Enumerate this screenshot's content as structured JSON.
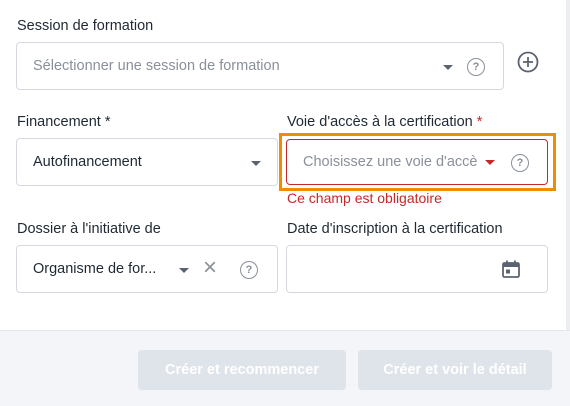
{
  "session": {
    "label": "Session de formation",
    "placeholder": "Sélectionner une session de formation"
  },
  "financement": {
    "label": "Financement",
    "required_mark": "*",
    "value": "Autofinancement"
  },
  "voie_acces": {
    "label": "Voie d'accès à la certification",
    "required_mark": "*",
    "placeholder": "Choisissez une voie d'accès",
    "error": "Ce champ est obligatoire"
  },
  "dossier": {
    "label": "Dossier à l'initiative de",
    "value": "Organisme de for..."
  },
  "date_inscription": {
    "label": "Date d'inscription à la certification"
  },
  "icons": {
    "help": "?",
    "clear": "×"
  },
  "footer": {
    "create_restart": "Créer et recommencer",
    "create_view": "Créer et voir le détail"
  },
  "colors": {
    "error": "#c62828",
    "focus_outline": "#f08c00",
    "button_disabled": "#dfe3ea"
  }
}
